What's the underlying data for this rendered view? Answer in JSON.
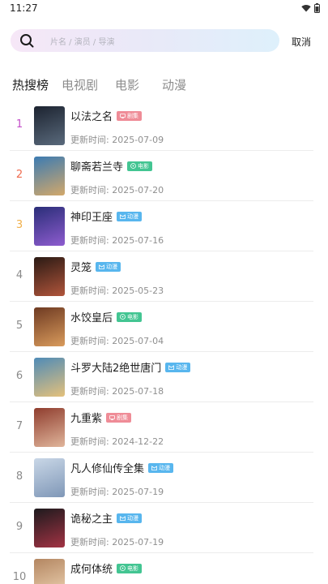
{
  "status": {
    "time": "11:27"
  },
  "search": {
    "placeholder": "片名 / 演员 / 导演",
    "cancel": "取消"
  },
  "tabs": [
    {
      "label": "热搜榜",
      "active": true
    },
    {
      "label": "电视剧",
      "active": false
    },
    {
      "label": "电影",
      "active": false
    },
    {
      "label": "动漫",
      "active": false
    }
  ],
  "update_prefix": "更新时间:",
  "colors": {
    "rank1": "#c34ec9",
    "rank2": "#ef6b4e",
    "rank3": "#f1b04a",
    "rank_default": "#8a8a8a"
  },
  "items": [
    {
      "rank": "1",
      "title": "以法之名",
      "badge": "剧集",
      "type": "drama",
      "date": "2025-07-09",
      "poster": [
        "#1c2330",
        "#5a6a7c"
      ]
    },
    {
      "rank": "2",
      "title": "聊斋若兰寺",
      "badge": "电影",
      "type": "movie",
      "date": "2025-07-20",
      "poster": [
        "#3c7bb2",
        "#d3a86a"
      ]
    },
    {
      "rank": "3",
      "title": "神印王座",
      "badge": "动漫",
      "type": "anime",
      "date": "2025-07-16",
      "poster": [
        "#2a2e78",
        "#8e5ccf"
      ]
    },
    {
      "rank": "4",
      "title": "灵笼",
      "badge": "动漫",
      "type": "anime",
      "date": "2025-05-23",
      "poster": [
        "#2a1a14",
        "#b1553b"
      ]
    },
    {
      "rank": "5",
      "title": "水饺皇后",
      "badge": "电影",
      "type": "movie",
      "date": "2025-07-04",
      "poster": [
        "#6e3a22",
        "#d99b5c"
      ]
    },
    {
      "rank": "6",
      "title": "斗罗大陆2绝世唐门",
      "badge": "动漫",
      "type": "anime",
      "date": "2025-07-18",
      "poster": [
        "#4f8bb7",
        "#e5c17b"
      ]
    },
    {
      "rank": "7",
      "title": "九重紫",
      "badge": "剧集",
      "type": "drama",
      "date": "2024-12-22",
      "poster": [
        "#8f3d2e",
        "#e0b59b"
      ]
    },
    {
      "rank": "8",
      "title": "凡人修仙传全集",
      "badge": "动漫",
      "type": "anime",
      "date": "2025-07-19",
      "poster": [
        "#c9d7e7",
        "#7f97b7"
      ]
    },
    {
      "rank": "9",
      "title": "诡秘之主",
      "badge": "动漫",
      "type": "anime",
      "date": "2025-07-19",
      "poster": [
        "#1d1a1d",
        "#a33344"
      ]
    },
    {
      "rank": "10",
      "title": "成何体统",
      "badge": "电影",
      "type": "movie",
      "date": "",
      "poster": [
        "#b38661",
        "#f0d6b6"
      ]
    }
  ]
}
